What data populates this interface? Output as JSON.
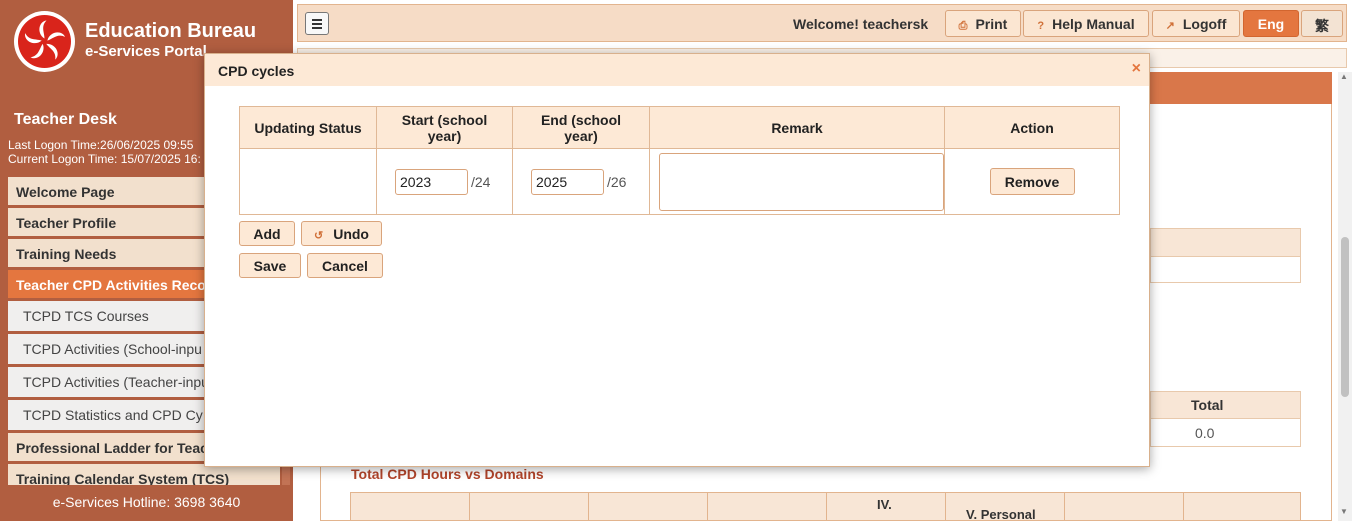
{
  "sidebar": {
    "bureau_name": "Education Bureau",
    "portal_name": "e-Services Portal",
    "desk_title": "Teacher Desk",
    "last_logon": "Last Logon Time:26/06/2025 09:55",
    "current_logon": "Current Logon Time: 15/07/2025 16:",
    "items": [
      {
        "label": "Welcome Page",
        "type": "main"
      },
      {
        "label": "Teacher Profile",
        "type": "main"
      },
      {
        "label": "Training Needs",
        "type": "main"
      },
      {
        "label": "Teacher CPD Activities Reco",
        "type": "active"
      },
      {
        "label": "TCPD TCS Courses",
        "type": "sub"
      },
      {
        "label": "TCPD Activities (School-inpu",
        "type": "sub"
      },
      {
        "label": "TCPD Activities (Teacher-inpu",
        "type": "sub"
      },
      {
        "label": "TCPD Statistics and CPD Cy",
        "type": "sub"
      },
      {
        "label": "Professional Ladder for Teac",
        "type": "main"
      },
      {
        "label": "Training Calendar System (TCS)",
        "type": "main"
      }
    ],
    "hotline": "e-Services Hotline: 3698 3640"
  },
  "topbar": {
    "welcome": "Welcome! teachersk",
    "print": "Print",
    "help": "Help Manual",
    "logoff": "Logoff",
    "lang_en": "Eng",
    "lang_tc": "繁"
  },
  "background": {
    "total_label": "Total",
    "total_value": "0.0",
    "chart_title": "Total CPD Hours vs Domains",
    "col_iv": "IV.",
    "col_v": "V. Personal"
  },
  "dialog": {
    "title": "CPD cycles",
    "close": "×",
    "columns": [
      "Updating Status",
      "Start (school year)",
      "End (school year)",
      "Remark",
      "Action"
    ],
    "rows": [
      {
        "status": "",
        "start_year": "2023",
        "start_suffix": "/24",
        "end_year": "2025",
        "end_suffix": "/26",
        "remark": "",
        "action": "Remove"
      }
    ],
    "add": "Add",
    "undo": "Undo",
    "save": "Save",
    "cancel": "Cancel"
  },
  "colors": {
    "sidebar_bg": "#b15e40",
    "accent": "#e4763f",
    "header_bg": "#fde9d6",
    "border": "#d9a47c"
  }
}
